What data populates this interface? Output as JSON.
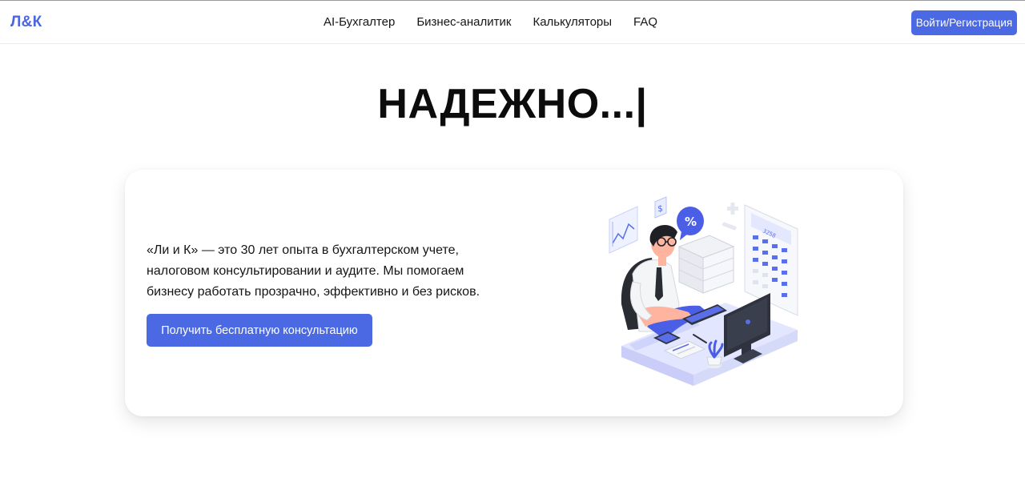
{
  "brand": {
    "logo": "Л&К",
    "accent_color": "#4a69e2"
  },
  "nav": {
    "items": [
      {
        "label": "AI-Бухгалтер"
      },
      {
        "label": "Бизнес-аналитик"
      },
      {
        "label": "Калькуляторы"
      },
      {
        "label": "FAQ"
      }
    ]
  },
  "header": {
    "login_label": "Войти/Регистрация"
  },
  "hero": {
    "title": "НАДЕЖНО...|"
  },
  "card": {
    "description": "«Ли и К» — это 30 лет опыта в бухгалтерском учете, налоговом консультировании и аудите. Мы помогаем бизнесу работать прозрачно, эффективно и без рисков.",
    "cta_label": "Получить бесплатную консультацию",
    "illustration": {
      "name": "accountant-at-desk-illustration",
      "percent_badge": "%",
      "dollar_badge": "$"
    }
  }
}
